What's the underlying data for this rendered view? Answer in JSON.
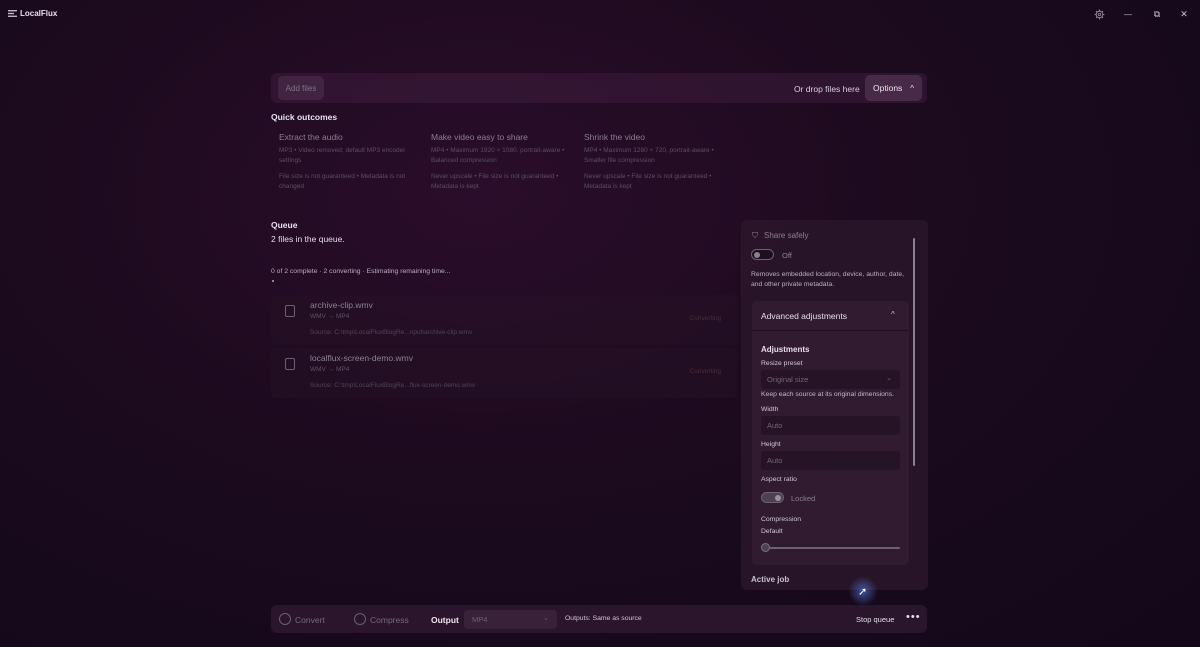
{
  "app": {
    "title": "LocalFlux"
  },
  "window": {
    "settings_icon": "gear-icon",
    "minimize": "—",
    "maximize": "⧉",
    "close": "✕"
  },
  "toolbar": {
    "add_files": "Add files",
    "drop_hint": "Or drop files here",
    "options_label": "Options",
    "options_chevron": "^"
  },
  "quick_outcomes": {
    "title": "Quick outcomes",
    "cards": [
      {
        "title": "Extract the audio",
        "desc": "MP3 • Video removed; default MP3 encoder settings",
        "note": "File size is not guaranteed • Metadata is not changed"
      },
      {
        "title": "Make video easy to share",
        "desc": "MP4 • Maximum 1920 × 1080, portrait-aware • Balanced compression",
        "note": "Never upscale • File size is not guaranteed • Metadata is kept"
      },
      {
        "title": "Shrink the video",
        "desc": "MP4 • Maximum 1280 × 720, portrait-aware • Smaller file compression",
        "note": "Never upscale • File size is not guaranteed • Metadata is kept"
      }
    ]
  },
  "queue": {
    "title": "Queue",
    "count_text": "2 files in the queue.",
    "progress_text": "0 of 2 complete · 2 converting · Estimating remaining time...",
    "jobs": [
      {
        "name": "archive-clip.wmv",
        "format": "WMV → MP4",
        "source": "Source: C:\\tmp\\LocalFluxBlogRe...nput\\archive-clip.wmv",
        "status": "Converting"
      },
      {
        "name": "localflux-screen-demo.wmv",
        "format": "WMV → MP4",
        "source": "Source: C:\\tmp\\LocalFluxBlogRe...flux-screen-demo.wmv",
        "status": "Converting"
      }
    ]
  },
  "options_panel": {
    "share_safely": {
      "title": "Share safely",
      "toggle_label": "Off",
      "description": "Removes embedded location, device, author, date, and other private metadata."
    },
    "advanced": {
      "header": "Advanced adjustments",
      "chevron": "^",
      "adjustments_title": "Adjustments",
      "resize_preset_label": "Resize preset",
      "resize_preset_value": "Original size",
      "resize_preset_hint": "Keep each source at its original dimensions.",
      "width_label": "Width",
      "width_placeholder": "Auto",
      "height_label": "Height",
      "height_placeholder": "Auto",
      "aspect_label": "Aspect ratio",
      "aspect_toggle_label": "Locked",
      "compression_label": "Compression",
      "compression_value": "Default"
    },
    "active_job_title": "Active job"
  },
  "bottom_bar": {
    "convert_label": "Convert",
    "compress_label": "Compress",
    "output_label": "Output",
    "format_value": "MP4",
    "outputs_text": "Outputs: Same as source",
    "stop_label": "Stop queue",
    "more_label": "•••"
  }
}
